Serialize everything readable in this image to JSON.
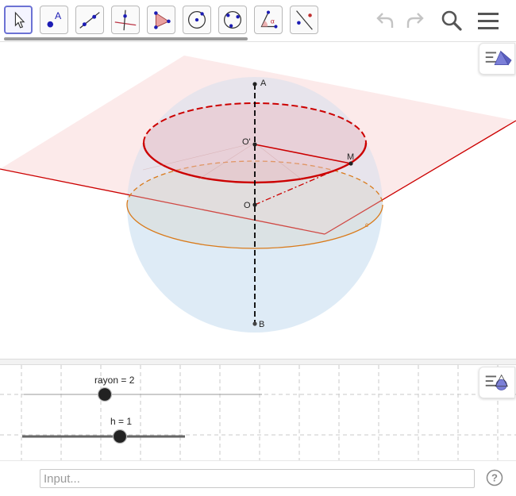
{
  "toolbar": {
    "tools": [
      {
        "name": "move-tool",
        "icon": "arrow-cursor-icon",
        "selected": true
      },
      {
        "name": "point-tool",
        "icon": "point-icon",
        "letter": "A"
      },
      {
        "name": "line-tool",
        "icon": "line-through-points-icon"
      },
      {
        "name": "perpendicular-line-tool",
        "icon": "perpendicular-line-icon"
      },
      {
        "name": "polygon-tool",
        "icon": "polygon-icon"
      },
      {
        "name": "circle-center-point-tool",
        "icon": "circle-center-point-icon"
      },
      {
        "name": "circle-three-points-tool",
        "icon": "circle-three-points-icon"
      },
      {
        "name": "angle-tool",
        "icon": "angle-icon",
        "letter": "α"
      },
      {
        "name": "reflect-tool",
        "icon": "reflect-about-line-icon"
      }
    ],
    "undo_icon": "undo-icon",
    "redo_icon": "redo-icon",
    "search_icon": "search-icon",
    "menu_icon": "menu-icon"
  },
  "view3d": {
    "points": {
      "A": "A",
      "B": "B",
      "O": "O",
      "O_prime": "O'",
      "M": "M",
      "small_label": "c"
    },
    "colors": {
      "sphere_fill": "#dbe9f6",
      "plane_fill": "#fdeaea",
      "plane_edge": "#cc0000",
      "section_circle": "#cc0000",
      "equator_circle": "#d97a1a",
      "axis": "#000000"
    },
    "stylebar_icon": "pyramid-graphics-icon"
  },
  "view2d": {
    "sliders": [
      {
        "name": "rayon",
        "value": "2",
        "min": 0,
        "max": 6,
        "fraction": 0.34
      },
      {
        "name": "h",
        "value": "1",
        "min": -2,
        "max": 2,
        "fraction": 0.6
      }
    ],
    "stylebar_icon": "graphics-view-icon"
  },
  "input_bar": {
    "placeholder": "Input...",
    "help_icon": "help-icon"
  }
}
